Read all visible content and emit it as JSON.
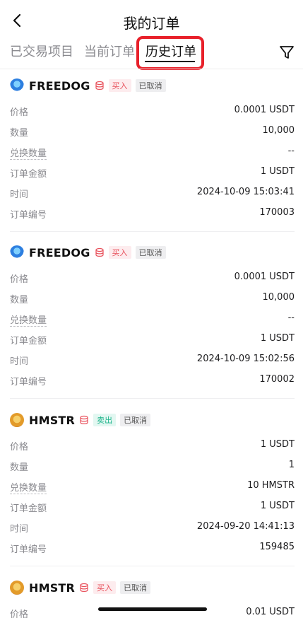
{
  "header": {
    "title": "我的订单"
  },
  "tabs": [
    {
      "label": "已交易项目"
    },
    {
      "label": "当前订单"
    },
    {
      "label": "历史订单"
    }
  ],
  "labels": {
    "price": "价格",
    "qty": "数量",
    "exchange_qty": "兑换数量",
    "amount": "订单金额",
    "time": "时间",
    "order_no": "订单编号"
  },
  "orders": [
    {
      "coin": "FREEDOG",
      "side": "买入",
      "status": "已取消",
      "price": "0.0001 USDT",
      "qty": "10,000",
      "exchange_qty": "--",
      "amount": "1 USDT",
      "time": "2024-10-09 15:03:41",
      "order_no": "170003"
    },
    {
      "coin": "FREEDOG",
      "side": "买入",
      "status": "已取消",
      "price": "0.0001 USDT",
      "qty": "10,000",
      "exchange_qty": "--",
      "amount": "1 USDT",
      "time": "2024-10-09 15:02:56",
      "order_no": "170002"
    },
    {
      "coin": "HMSTR",
      "side": "卖出",
      "status": "已取消",
      "price": "1 USDT",
      "qty": "1",
      "exchange_qty": "10 HMSTR",
      "amount": "1 USDT",
      "time": "2024-09-20 14:41:13",
      "order_no": "159485"
    },
    {
      "coin": "HMSTR",
      "side": "买入",
      "status": "已取消",
      "price": "0.01 USDT"
    }
  ],
  "colors": {
    "buy": "#e8505b",
    "sell": "#1bb38a",
    "highlight": "#e8202a"
  }
}
